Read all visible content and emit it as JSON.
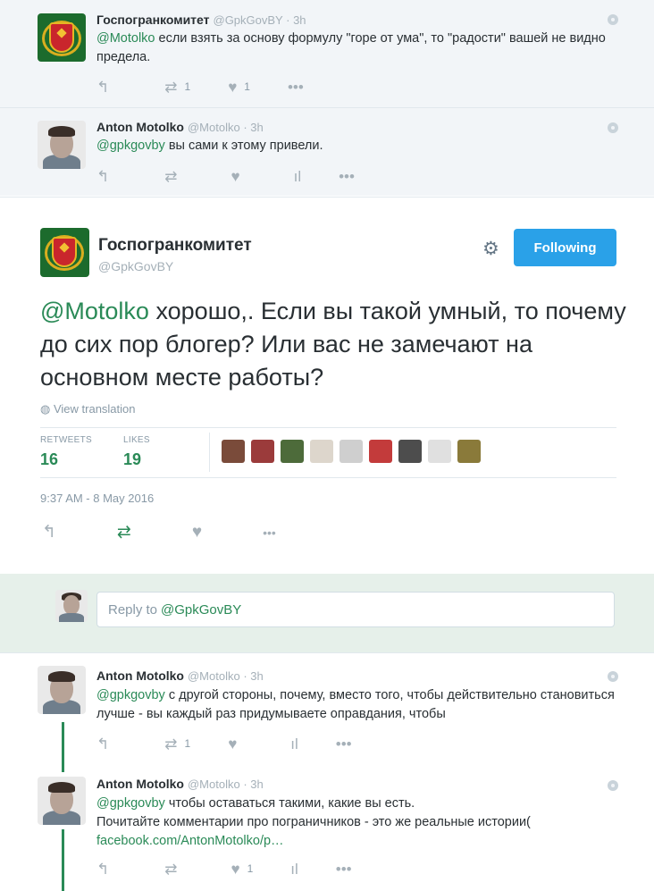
{
  "tweet1": {
    "name": "Госпогранкомитет",
    "handle": "@GpkGovBY",
    "time": "3h",
    "mention": "@Motolko",
    "text": " если взять за основу формулу \"горе от ума\", то \"радости\" вашей не видно предела.",
    "retweets": "1",
    "likes": "1"
  },
  "tweet2": {
    "name": "Anton Motolko",
    "handle": "@Motolko",
    "time": "3h",
    "mention": "@gpkgovby",
    "text": " вы сами к этому привели."
  },
  "main": {
    "name": "Госпогранкомитет",
    "handle": "@GpkGovBY",
    "follow_label": "Following",
    "mention": "@Motolko",
    "text": "  хорошо,. Если вы такой умный, то почему до сих пор блогер?  Или вас не замечают на основном месте работы?",
    "view_translation": "View translation",
    "retweets_label": "RETWEETS",
    "retweets": "16",
    "likes_label": "LIKES",
    "likes": "19",
    "timestamp": "9:37 AM - 8 May 2016",
    "liker_face_colors": [
      "#7a4b3a",
      "#9b3b3b",
      "#4d6b3a",
      "#ddd6cc",
      "#cfcfcf",
      "#c33b3b",
      "#4d4d4d",
      "#e0e0e0",
      "#8a7a3a"
    ]
  },
  "reply_box": {
    "placeholder": "Reply to",
    "mention": "@GpkGovBY"
  },
  "tweet3": {
    "name": "Anton Motolko",
    "handle": "@Motolko",
    "time": "3h",
    "mention": "@gpkgovby",
    "text": " с другой стороны, почему, вместо того, чтобы действительно становиться лучше - вы каждый раз придумываете оправдания, чтобы",
    "retweets": "1"
  },
  "tweet4": {
    "name": "Anton Motolko",
    "handle": "@Motolko",
    "time": "3h",
    "mention": "@gpkgovby",
    "line1": " чтобы оставаться такими, какие вы есть.",
    "line2": "Почитайте комментарии про пограничников - это же реальные истории(",
    "link": "facebook.com/AntonMotolko/p…",
    "likes": "1"
  },
  "accent_color": "#2a8a57",
  "follow_button_color": "#2aa1e8"
}
